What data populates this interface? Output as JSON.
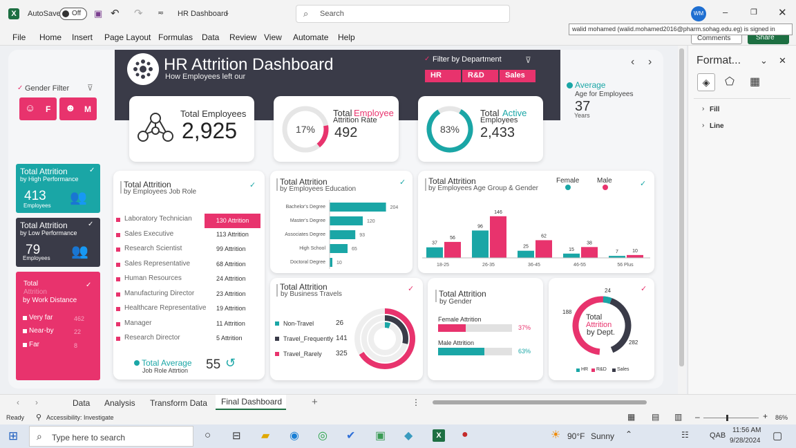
{
  "titlebar": {
    "autosave_label": "AutoSave",
    "autosave_state": "Off",
    "file_name": "HR Dashboard",
    "search_placeholder": "Search",
    "user_initials": "WM",
    "tooltip": "walid mohamed (walid.mohamed2016@pharm.sohag.edu.eg) is signed in"
  },
  "ribbon": {
    "tabs": [
      "File",
      "Home",
      "Insert",
      "Page Layout",
      "Formulas",
      "Data",
      "Review",
      "View",
      "Automate",
      "Help"
    ],
    "comments_label": "Comments",
    "share_label": "Share"
  },
  "dashboard": {
    "title": "HR Attrition Dashboard",
    "subtitle": "How Employees left our",
    "filter_department": {
      "label": "Filter by Department",
      "options": [
        "HR",
        "R&D",
        "Sales"
      ]
    },
    "gender_filter": {
      "label": "Gender Filter",
      "options": [
        "F",
        "M"
      ]
    },
    "average": {
      "label": "Average",
      "sub": "Age for Employees",
      "value": "37",
      "unit": "Years"
    },
    "kpis": [
      {
        "title": "Total Employees",
        "value": "2,925"
      },
      {
        "title_a": "Total ",
        "title_b": "Employee",
        "title_c": "Attrition Rate",
        "percent": "17%",
        "value": "492"
      },
      {
        "title_a": "Total ",
        "title_b": "Active",
        "title_c": "Employees",
        "percent": "83%",
        "value": "2,433"
      }
    ],
    "high_perf": {
      "title": "Total Attrition",
      "sub": "by High Performance",
      "value": "413",
      "unit": "Employees"
    },
    "low_perf": {
      "title": "Total Attrition",
      "sub": "by Low Performance",
      "value": "79",
      "unit": "Employees"
    },
    "distance": {
      "title": "Total",
      "title2": "Attrition",
      "sub": "by Work Distance",
      "items": [
        {
          "label": "Very far",
          "value": "462"
        },
        {
          "label": "Near-by",
          "value": "22"
        },
        {
          "label": "Far",
          "value": "8"
        }
      ]
    },
    "job_role": {
      "title": "Total Attrition",
      "sub": "by Employees Job Role",
      "rows": [
        {
          "role": "Laboratory Technician",
          "value": "130 Attrition"
        },
        {
          "role": "Sales Executive",
          "value": "113 Attrition"
        },
        {
          "role": "Research Scientist",
          "value": "99 Attrition"
        },
        {
          "role": "Sales Representative",
          "value": "68 Attrition"
        },
        {
          "role": "Human Resources",
          "value": "24 Attrition"
        },
        {
          "role": "Manufacturing Director",
          "value": "23 Attrition"
        },
        {
          "role": "Healthcare Representative",
          "value": "19 Attrition"
        },
        {
          "role": "Manager",
          "value": "11 Attrition"
        },
        {
          "role": "Research Director",
          "value": "5 Attrition"
        }
      ],
      "avg_label": "Total Average",
      "avg_sub": "Job Role Attrtion",
      "avg_value": "55"
    },
    "education": {
      "title": "Total Attrition",
      "sub": "by Employees Education"
    },
    "age_gender": {
      "title": "Total Attrition",
      "sub": "by Employees Age Group & Gender",
      "legend": [
        "Female",
        "Male"
      ]
    },
    "travel": {
      "title": "Total Attrition",
      "sub": "by Business Travels",
      "rows": [
        {
          "label": "Non-Travel",
          "value": "26"
        },
        {
          "label": "Travel_Frequently",
          "value": "141"
        },
        {
          "label": "Travel_Rarely",
          "value": "325"
        }
      ]
    },
    "by_gender": {
      "title": "Total Attrition",
      "sub": "by Gender",
      "rows": [
        {
          "label": "Female Attrition",
          "value": "37%"
        },
        {
          "label": "Male Attrition",
          "value": "63%"
        }
      ]
    },
    "by_dept": {
      "title1": "Total",
      "title2": "Attrition",
      "title3": "by Dept.",
      "legend": [
        "HR",
        "R&D",
        "Sales"
      ],
      "values": [
        "24",
        "188",
        "282"
      ]
    }
  },
  "chart_data": [
    {
      "type": "bar",
      "categories": [
        "Bachelor's Degree",
        "Master's Degree",
        "Associates Degree",
        "High School",
        "Doctoral Degree"
      ],
      "values": [
        204,
        120,
        93,
        65,
        10
      ]
    },
    {
      "type": "bar",
      "categories": [
        "18-25",
        "26-35",
        "36-45",
        "46-55",
        "56 Plus"
      ],
      "series": [
        {
          "name": "Female",
          "values": [
            37,
            96,
            25,
            15,
            7
          ]
        },
        {
          "name": "Male",
          "values": [
            56,
            146,
            62,
            38,
            10
          ]
        }
      ]
    }
  ],
  "format_panel": {
    "title": "Format...",
    "items": [
      "Fill",
      "Line"
    ]
  },
  "sheet_tabs": [
    "Data",
    "Analysis",
    "Transform Data",
    "Final Dashboard"
  ],
  "status": {
    "ready": "Ready",
    "accessibility": "Accessibility: Investigate",
    "zoom": "86%"
  },
  "taskbar": {
    "search": "Type here to search",
    "weather_temp": "90°F",
    "weather_text": "Sunny",
    "lang": "QAB",
    "time": "11:56 AM",
    "date": "9/28/2024"
  },
  "colors": {
    "teal": "#1aa6a6",
    "pink": "#e8336d",
    "dark": "#3a3b48",
    "excel_green": "#1d6f42"
  }
}
